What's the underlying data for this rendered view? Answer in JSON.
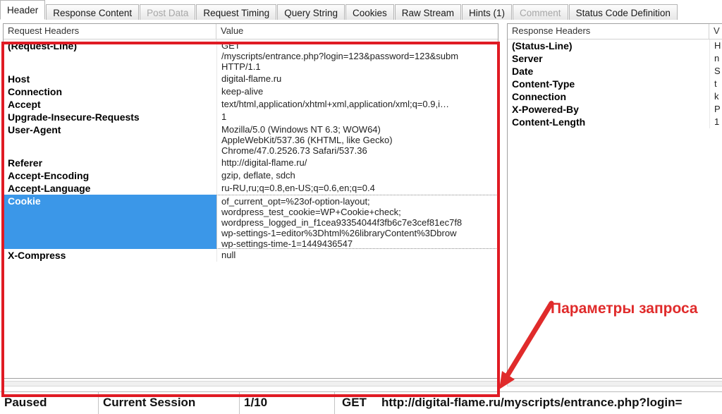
{
  "tabs": [
    {
      "label": "Header",
      "state": "active"
    },
    {
      "label": "Response Content",
      "state": "normal"
    },
    {
      "label": "Post Data",
      "state": "disabled"
    },
    {
      "label": "Request Timing",
      "state": "normal"
    },
    {
      "label": "Query String",
      "state": "normal"
    },
    {
      "label": "Cookies",
      "state": "normal"
    },
    {
      "label": "Raw Stream",
      "state": "normal"
    },
    {
      "label": "Hints (1)",
      "state": "normal"
    },
    {
      "label": "Comment",
      "state": "disabled"
    },
    {
      "label": "Status Code Definition",
      "state": "normal"
    }
  ],
  "request_panel": {
    "col_name": "Request Headers",
    "col_value": "Value",
    "rows": [
      {
        "name": "(Request-Line)",
        "value": "GET\n/myscripts/entrance.php?login=123&password=123&subm\nHTTP/1.1",
        "selected": false
      },
      {
        "name": "Host",
        "value": "digital-flame.ru",
        "selected": false
      },
      {
        "name": "Connection",
        "value": "keep-alive",
        "selected": false
      },
      {
        "name": "Accept",
        "value": "text/html,application/xhtml+xml,application/xml;q=0.9,i…",
        "selected": false
      },
      {
        "name": "Upgrade-Insecure-Requests",
        "value": "1",
        "selected": false
      },
      {
        "name": "User-Agent",
        "value": "Mozilla/5.0 (Windows NT 6.3; WOW64)\nAppleWebKit/537.36 (KHTML, like Gecko)\nChrome/47.0.2526.73 Safari/537.36",
        "selected": false
      },
      {
        "name": "Referer",
        "value": "http://digital-flame.ru/",
        "selected": false
      },
      {
        "name": "Accept-Encoding",
        "value": "gzip, deflate, sdch",
        "selected": false
      },
      {
        "name": "Accept-Language",
        "value": "ru-RU,ru;q=0.8,en-US;q=0.6,en;q=0.4",
        "selected": false
      },
      {
        "name": "Cookie",
        "value": "of_current_opt=%23of-option-layout;\nwordpress_test_cookie=WP+Cookie+check;\nwordpress_logged_in_f1cea93354044f3fb6c7e3cef81ec7f8\nwp-settings-1=editor%3Dhtml%26libraryContent%3Dbrow\nwp-settings-time-1=1449436547",
        "selected": true
      },
      {
        "name": "X-Compress",
        "value": "null",
        "selected": false
      }
    ]
  },
  "response_panel": {
    "col_name": "Response Headers",
    "col_value": "V",
    "rows": [
      {
        "name": "(Status-Line)",
        "value": "H"
      },
      {
        "name": "Server",
        "value": "n"
      },
      {
        "name": "Date",
        "value": "S"
      },
      {
        "name": "Content-Type",
        "value": "t"
      },
      {
        "name": "Connection",
        "value": "k"
      },
      {
        "name": "X-Powered-By",
        "value": "P"
      },
      {
        "name": "Content-Length",
        "value": "1"
      }
    ]
  },
  "annotation": {
    "text": "Параметры запроса",
    "color": "#e02b2b"
  },
  "statusbar": {
    "state": "Paused",
    "session": "Current Session",
    "counter": "1/10",
    "method": "GET",
    "url": "http://digital-flame.ru/myscripts/entrance.php?login="
  }
}
